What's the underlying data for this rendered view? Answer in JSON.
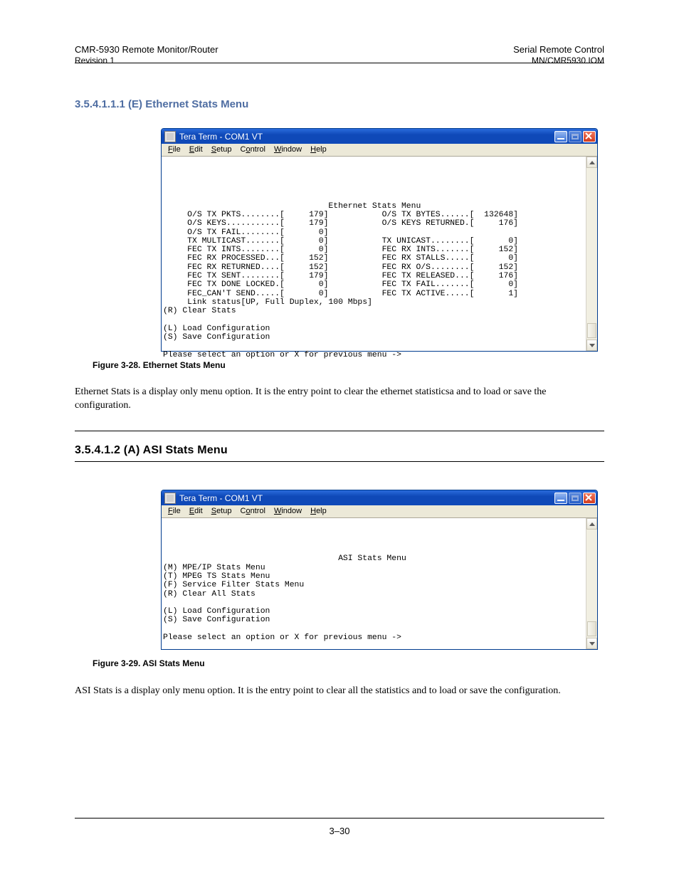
{
  "page": {
    "top_heading": "Serial Remote Control",
    "product_small": "CMR-5930 Remote Monitor/Router",
    "subtitle": "Revision 1",
    "page_number": "3–30",
    "manual_id": "MN/CMR5930.IOM"
  },
  "section_a": {
    "heading": "3.5.4.1.1.1 (E) Ethernet Stats Menu",
    "caption": "Figure 3-28.  Ethernet Stats Menu",
    "body": "Ethernet Stats is a display only menu option.  It is the entry point to clear the ethernet statisticsa and to load or save the configuration.",
    "window_title": "Tera Term - COM1 VT",
    "menus": [
      "File",
      "Edit",
      "Setup",
      "Control",
      "Window",
      "Help"
    ],
    "terminal_title": "Ethernet Stats Menu",
    "rows": [
      {
        "l_label": "O/S TX PKTS........",
        "l_val": "179",
        "r_label": "O/S TX BYTES......",
        "r_val": "132648"
      },
      {
        "l_label": "O/S KEYS...........",
        "l_val": "179",
        "r_label": "O/S KEYS RETURNED.",
        "r_val": "176"
      },
      {
        "l_label": "O/S TX FAIL........",
        "l_val": "0"
      },
      {
        "l_label": "TX MULTICAST.......",
        "l_val": "0",
        "r_label": "TX UNICAST........",
        "r_val": "0"
      },
      {
        "l_label": "FEC TX INTS........",
        "l_val": "0",
        "r_label": "FEC RX INTS.......",
        "r_val": "152"
      },
      {
        "l_label": "FEC RX PROCESSED...",
        "l_val": "152",
        "r_label": "FEC RX STALLS.....",
        "r_val": "0"
      },
      {
        "l_label": "FEC RX RETURNED....",
        "l_val": "152",
        "r_label": "FEC RX O/S........",
        "r_val": "152"
      },
      {
        "l_label": "FEC TX SENT........",
        "l_val": "179",
        "r_label": "FEC TX RELEASED...",
        "r_val": "176"
      },
      {
        "l_label": "FEC TX DONE LOCKED.",
        "l_val": "0",
        "r_label": "FEC TX FAIL.......",
        "r_val": "0"
      },
      {
        "l_label": "FEC_CAN'T SEND.....",
        "l_val": "0",
        "r_label": "FEC TX ACTIVE.....",
        "r_val": "1"
      }
    ],
    "link_status": "Link status[UP, Full Duplex, 100 Mbps]",
    "opts": [
      "(R) Clear Stats",
      "",
      "(L) Load Configuration",
      "(S) Save Configuration"
    ],
    "prompt": "Please select an option or X for previous menu ->"
  },
  "section_b": {
    "heading": "3.5.4.1.2 (A) ASI Stats Menu",
    "caption": "Figure 3-29.  ASI Stats Menu",
    "body": "ASI Stats is a display only menu option.  It is the entry point to clear all the statistics and to load or save the configuration.",
    "window_title": "Tera Term - COM1 VT",
    "menus": [
      "File",
      "Edit",
      "Setup",
      "Control",
      "Window",
      "Help"
    ],
    "terminal_title": "ASI Stats Menu",
    "opts": [
      "(M) MPE/IP Stats Menu",
      "(T) MPEG TS Stats Menu",
      "(F) Service Filter Stats Menu",
      "(R) Clear All Stats",
      "",
      "(L) Load Configuration",
      "(S) Save Configuration"
    ],
    "prompt": "Please select an option or X for previous menu ->"
  }
}
